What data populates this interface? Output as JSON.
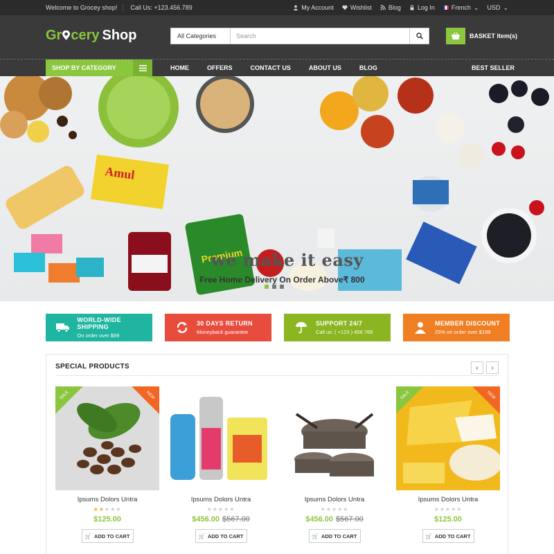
{
  "topbar": {
    "welcome": "Welcome to Grocey shop!",
    "phone": "Call Us: +123.456.789",
    "my_account": "My Account",
    "wishlist": "Wishlist",
    "blog": "Blog",
    "login": "Log In",
    "language": "French",
    "currency": "USD"
  },
  "header": {
    "logo_part1": "Gr",
    "logo_part2": "cery",
    "logo_part3": "Shop",
    "category_select": "All Categories",
    "search_placeholder": "Search",
    "basket_label": "BASKET Item(s)"
  },
  "nav": {
    "category_button": "SHOP BY CATEGORY",
    "links": [
      "HOME",
      "OFFERS",
      "CONTACT US",
      "ABOUT US",
      "BLOG"
    ],
    "best_seller": "BEST SELLER"
  },
  "banner": {
    "tagline": "we make it easy",
    "subline": "Free Home Delivery On Order Above₹ 800",
    "slide_count": 3,
    "active_slide": 1
  },
  "features": [
    {
      "title": "WORLD-WIDE SHIPPING",
      "sub": "On order over $99",
      "color": "#1fb5a0",
      "icon": "truck-icon"
    },
    {
      "title": "30 DAYS RETURN",
      "sub": "Moneyback guarantee",
      "color": "#e84c3d",
      "icon": "refresh-icon"
    },
    {
      "title": "SUPPORT 24/7",
      "sub": "Call us: ( +123 ) 456 789",
      "color": "#8bb521",
      "icon": "umbrella-icon"
    },
    {
      "title": "MEMBER DISCOUNT",
      "sub": "25% on order over $199",
      "color": "#ef7f22",
      "icon": "user-icon"
    }
  ],
  "special": {
    "title": "SPECIAL PRODUCTS",
    "products": [
      {
        "name": "Ipsums Dolors Untra",
        "price": "$125.00",
        "old_price": "",
        "rating": 2,
        "sale": "SALE",
        "new": "NEW"
      },
      {
        "name": "Ipsums Dolors Untra",
        "price": "$456.00",
        "old_price": "$567.00",
        "rating": 0,
        "sale": "",
        "new": ""
      },
      {
        "name": "Ipsums Dolors Untra",
        "price": "$456.00",
        "old_price": "$567.00",
        "rating": 0,
        "sale": "",
        "new": ""
      },
      {
        "name": "Ipsums Dolors Untra",
        "price": "$125.00",
        "old_price": "",
        "rating": 0,
        "sale": "SALE",
        "new": "NEW"
      }
    ],
    "add_to_cart": "ADD TO CART"
  },
  "colors": {
    "accent": "#8bc63f",
    "dark": "#3a3a3a",
    "topbar": "#2b2b2b"
  }
}
